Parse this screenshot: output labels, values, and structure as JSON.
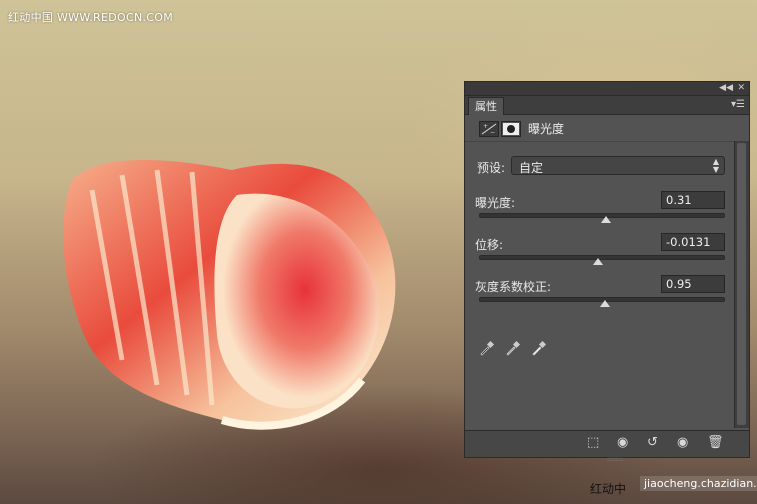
{
  "watermark_top": "红动中国 WWW.REDOCN.COM",
  "watermark_bottom_left": "红动中",
  "watermark_bottom_right": "jiaocheng.chazidian.com",
  "panel": {
    "tab_label": "属性",
    "header_title": "曝光度",
    "preset": {
      "label": "预设:",
      "value": "自定"
    },
    "sliders": [
      {
        "label": "曝光度:",
        "value": "0.31",
        "position": 0.52
      },
      {
        "label": "位移:",
        "value": "-0.0131",
        "position": 0.49
      },
      {
        "label": "灰度系数校正:",
        "value": "0.95",
        "position": 0.52
      }
    ]
  },
  "colors": {
    "panel_bg": "#535353",
    "panel_dark": "#3a3a3a",
    "field_bg": "#3c3c3c",
    "text": "#e6e6e6"
  },
  "icons": [
    "collapse-icon",
    "close-icon",
    "panel-menu-icon",
    "adjustment-icon",
    "mask-icon",
    "eyedropper-black-icon",
    "eyedropper-gray-icon",
    "eyedropper-white-icon",
    "clip-to-layer-icon",
    "view-previous-icon",
    "reset-icon",
    "visibility-icon",
    "delete-icon"
  ]
}
